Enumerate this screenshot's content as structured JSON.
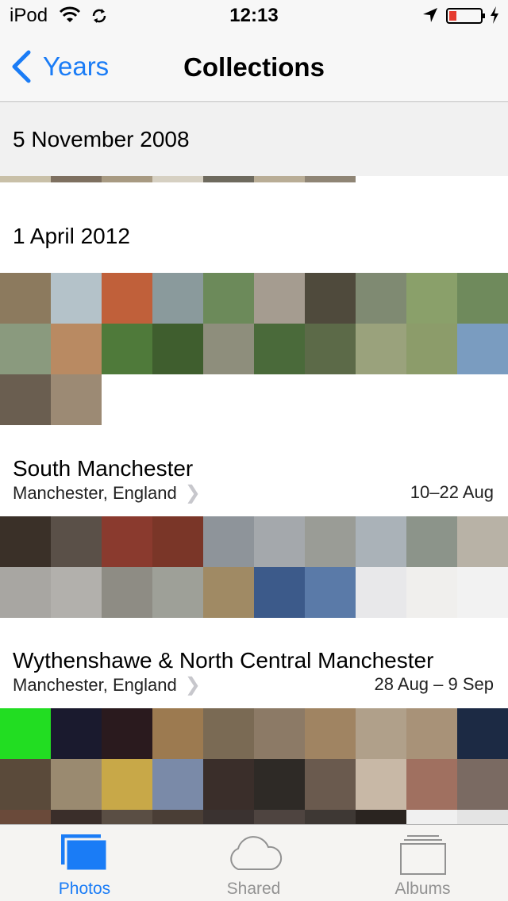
{
  "status_bar": {
    "carrier": "iPod",
    "time": "12:13"
  },
  "nav": {
    "back_label": "Years",
    "title": "Collections"
  },
  "sections": [
    {
      "title": "5 November 2008"
    },
    {
      "title": "1 April 2012"
    },
    {
      "title": "South Manchester",
      "location": "Manchester, England",
      "dates": "10–22 Aug"
    },
    {
      "title": "Wythenshawe & North Central Manchester",
      "location": "Manchester, England",
      "dates": "28 Aug – 9 Sep"
    }
  ],
  "tabs": [
    {
      "label": "Photos",
      "active": true
    },
    {
      "label": "Shared",
      "active": false
    },
    {
      "label": "Albums",
      "active": false
    }
  ],
  "colors": {
    "accent": "#1a7cf6",
    "inactive": "#929292"
  }
}
